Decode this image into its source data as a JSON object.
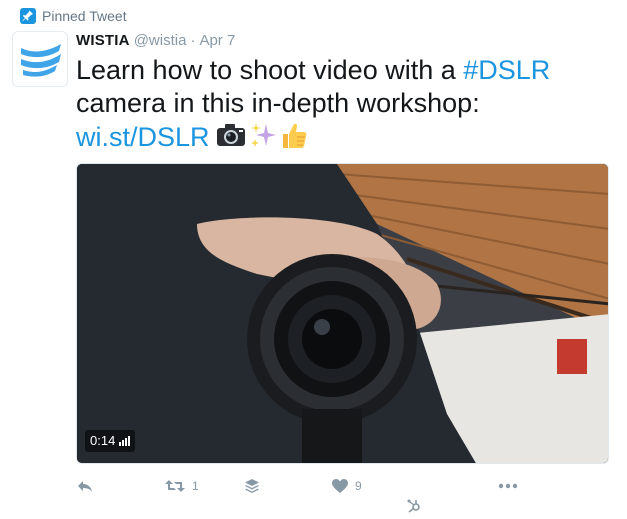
{
  "pinned": {
    "label": "Pinned Tweet"
  },
  "tweet": {
    "name": "WISTIA",
    "handle": "@wistia",
    "separator": "·",
    "date": "Apr 7",
    "text_part1": "Learn how to shoot video with a ",
    "hashtag": "#DSLR",
    "text_part2": "camera in this in-depth workshop:",
    "link": "wi.st/DSLR",
    "emojis": [
      "camera-emoji",
      "sparkles-emoji",
      "thumbs-up-emoji"
    ]
  },
  "media": {
    "duration": "0:14"
  },
  "actions": {
    "retweet_count": "1",
    "like_count": "9"
  },
  "colors": {
    "link": "#1b95e0",
    "muted": "#8899a6",
    "brand": "#3fa4e8"
  }
}
